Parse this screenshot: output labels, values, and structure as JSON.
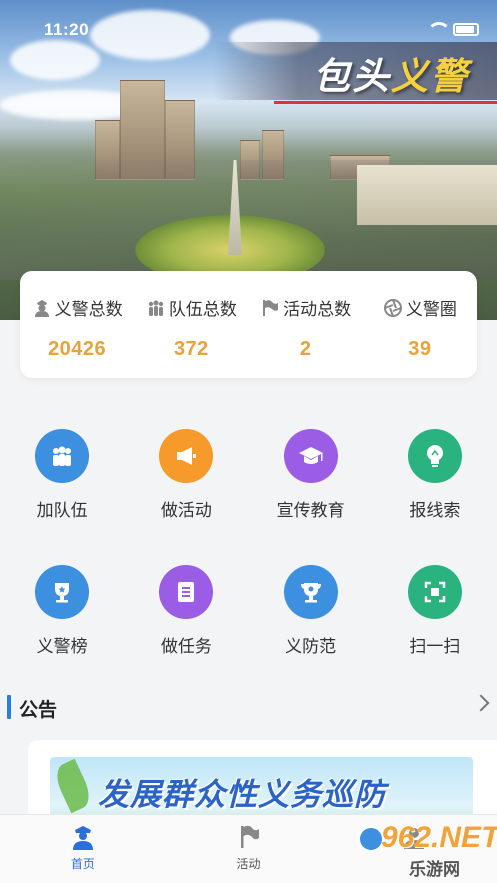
{
  "status_bar": {
    "time": "11:20"
  },
  "hero": {
    "title_main": "包头",
    "title_accent": "义警"
  },
  "stats": [
    {
      "label": "义警总数",
      "value": "20426",
      "icon": "police-officer-icon"
    },
    {
      "label": "队伍总数",
      "value": "372",
      "icon": "team-people-icon"
    },
    {
      "label": "活动总数",
      "value": "2",
      "icon": "flag-icon"
    },
    {
      "label": "义警圈",
      "value": "39",
      "icon": "aperture-icon"
    }
  ],
  "menu": [
    {
      "label": "加队伍",
      "icon": "team-icon",
      "color": "#3d8fe0"
    },
    {
      "label": "做活动",
      "icon": "megaphone-icon",
      "color": "#f59a2b"
    },
    {
      "label": "宣传教育",
      "icon": "graduation-cap-icon",
      "color": "#9b5de5"
    },
    {
      "label": "报线索",
      "icon": "lightbulb-icon",
      "color": "#2bb37f"
    },
    {
      "label": "义警榜",
      "icon": "trophy-icon",
      "color": "#3d8fe0"
    },
    {
      "label": "做任务",
      "icon": "clipboard-icon",
      "color": "#9b5de5"
    },
    {
      "label": "义防范",
      "icon": "trophy-cup-icon",
      "color": "#3d8fe0"
    },
    {
      "label": "扫一扫",
      "icon": "scan-icon",
      "color": "#2bb37f"
    }
  ],
  "notice": {
    "title": "公告",
    "banner_text": "发展群众性义务巡防"
  },
  "tabbar": [
    {
      "label": "首页",
      "icon": "police-home-icon",
      "active": true
    },
    {
      "label": "活动",
      "icon": "flag-tab-icon",
      "active": false
    },
    {
      "label": "",
      "icon": "profile-icon",
      "active": false
    }
  ],
  "watermark": {
    "brand": "962.NET",
    "sub": "乐游网"
  }
}
